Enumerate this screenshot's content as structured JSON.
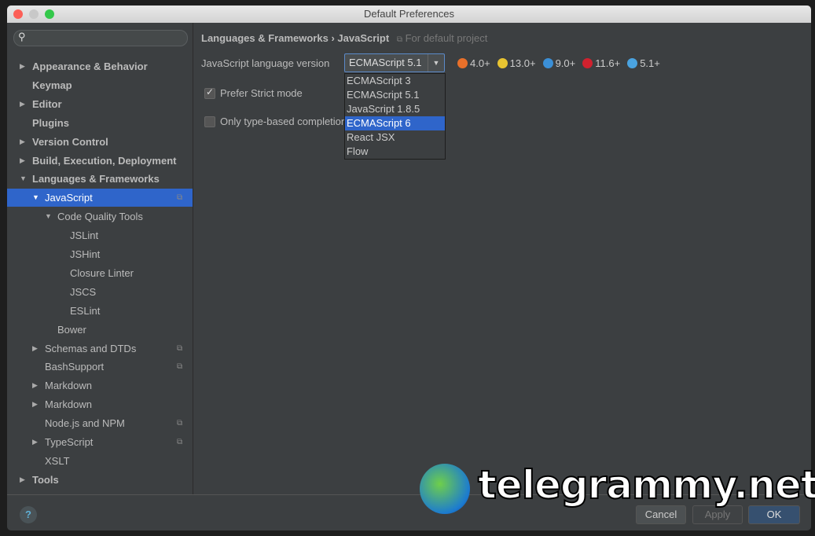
{
  "window": {
    "title": "Default Preferences"
  },
  "sidebar": {
    "search_placeholder": "",
    "items": [
      {
        "label": "Appearance & Behavior",
        "level": 0,
        "arrow": "▶",
        "bold": true
      },
      {
        "label": "Keymap",
        "level": 0,
        "arrow": "",
        "bold": true
      },
      {
        "label": "Editor",
        "level": 0,
        "arrow": "▶",
        "bold": true
      },
      {
        "label": "Plugins",
        "level": 0,
        "arrow": "",
        "bold": true
      },
      {
        "label": "Version Control",
        "level": 0,
        "arrow": "▶",
        "bold": true
      },
      {
        "label": "Build, Execution, Deployment",
        "level": 0,
        "arrow": "▶",
        "bold": true
      },
      {
        "label": "Languages & Frameworks",
        "level": 0,
        "arrow": "▼",
        "bold": true
      },
      {
        "label": "JavaScript",
        "level": 1,
        "arrow": "▼",
        "selected": true,
        "copy": true
      },
      {
        "label": "Code Quality Tools",
        "level": 2,
        "arrow": "▼"
      },
      {
        "label": "JSLint",
        "level": 3,
        "arrow": ""
      },
      {
        "label": "JSHint",
        "level": 3,
        "arrow": ""
      },
      {
        "label": "Closure Linter",
        "level": 3,
        "arrow": ""
      },
      {
        "label": "JSCS",
        "level": 3,
        "arrow": ""
      },
      {
        "label": "ESLint",
        "level": 3,
        "arrow": ""
      },
      {
        "label": "Bower",
        "level": 2,
        "arrow": ""
      },
      {
        "label": "Schemas and DTDs",
        "level": 1,
        "arrow": "▶",
        "copy": true
      },
      {
        "label": "BashSupport",
        "level": 1,
        "arrow": "",
        "copy": true
      },
      {
        "label": "Markdown",
        "level": 1,
        "arrow": "▶"
      },
      {
        "label": "Markdown",
        "level": 1,
        "arrow": "▶"
      },
      {
        "label": "Node.js and NPM",
        "level": 1,
        "arrow": "",
        "copy": true
      },
      {
        "label": "TypeScript",
        "level": 1,
        "arrow": "▶",
        "copy": true
      },
      {
        "label": "XSLT",
        "level": 1,
        "arrow": ""
      },
      {
        "label": "Tools",
        "level": 0,
        "arrow": "▶",
        "bold": true
      }
    ]
  },
  "main": {
    "breadcrumb": {
      "parent": "Languages & Frameworks",
      "separator": "›",
      "current": "JavaScript",
      "scope": "For default project"
    },
    "language_version_label": "JavaScript language version",
    "language_version_value": "ECMAScript 5.1",
    "browsers": [
      {
        "name": "firefox-icon",
        "version": "4.0+",
        "color": "#e8702a"
      },
      {
        "name": "chrome-icon",
        "version": "13.0+",
        "color": "#e8c431"
      },
      {
        "name": "ie-icon",
        "version": "9.0+",
        "color": "#3b8fd6"
      },
      {
        "name": "opera-icon",
        "version": "11.6+",
        "color": "#d0212e"
      },
      {
        "name": "safari-icon",
        "version": "5.1+",
        "color": "#4aa3e0"
      }
    ],
    "dropdown_options": [
      "ECMAScript 3",
      "ECMAScript 5.1",
      "JavaScript 1.8.5",
      "ECMAScript 6",
      "React JSX",
      "Flow"
    ],
    "dropdown_highlighted": "ECMAScript 6",
    "prefer_strict_label": "Prefer Strict mode",
    "prefer_strict_checked": true,
    "type_based_label": "Only type-based completion",
    "type_based_checked": false
  },
  "footer": {
    "help": "?",
    "cancel": "Cancel",
    "apply": "Apply",
    "ok": "OK"
  },
  "watermark": "telegrammy.net"
}
